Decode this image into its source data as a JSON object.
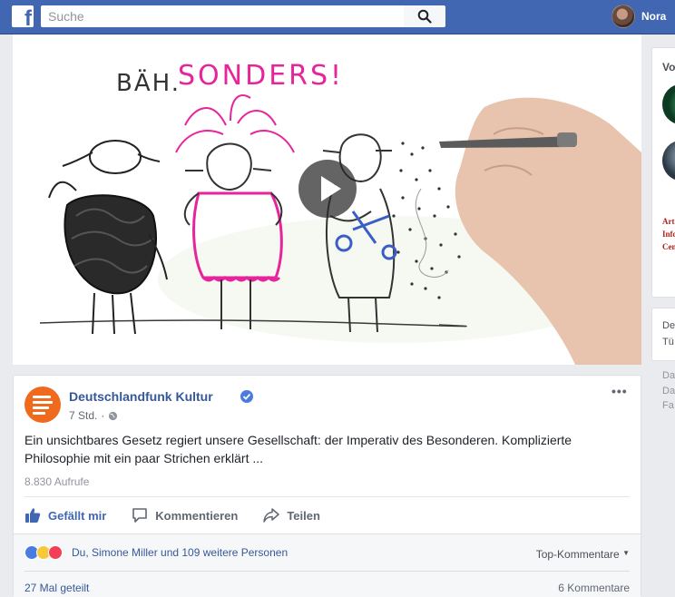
{
  "topbar": {
    "logo_letter": "f",
    "search_placeholder": "Suche",
    "user_name": "Nora"
  },
  "video": {
    "drawing_texts": [
      "BÄH.",
      "SONDERS!"
    ]
  },
  "post": {
    "page_name": "Deutschlandfunk Kultur",
    "time": "7 Std.",
    "text": "Ein unsichtbares Gesetz regiert unsere Gesellschaft: der Imperativ des Besonderen. Komplizierte Philosophie mit ein paar Strichen erklärt ...",
    "views": "8.830 Aufrufe",
    "actions": {
      "like": "Gefällt mir",
      "comment": "Kommentieren",
      "share": "Teilen"
    },
    "reactions_text": "Du, Simone Miller und 109 weitere Personen",
    "top_comments": "Top-Kommentare",
    "shares": "27 Mal geteilt",
    "comments": "6 Kommentare"
  },
  "right_column": {
    "card1_title": "Vo",
    "card1_red_text": [
      "Art",
      "Info",
      "Cen"
    ],
    "card2_lines": [
      "De",
      "Tü"
    ],
    "footer_lines": [
      "Da",
      "Da",
      "Fa"
    ]
  },
  "colors": {
    "brand": "#4267b2",
    "link": "#365899",
    "page_logo": "#f06a1d",
    "marker_pink": "#e8249c"
  }
}
